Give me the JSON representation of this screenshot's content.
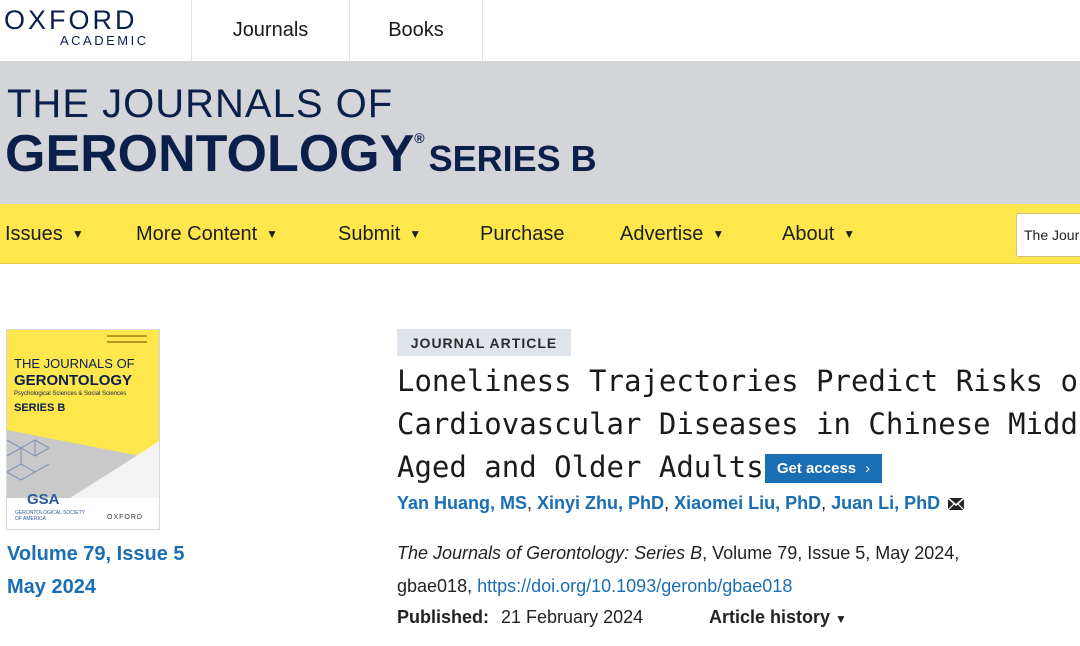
{
  "top": {
    "logo_main": "OXFORD",
    "logo_sub": "ACADEMIC",
    "links": [
      "Journals",
      "Books"
    ]
  },
  "banner": {
    "line1": "THE JOURNALS OF",
    "line2": "GERONTOLOGY",
    "reg": "®",
    "series": "SERIES B"
  },
  "nav": {
    "items": [
      "Issues",
      "More Content",
      "Submit",
      "Purchase",
      "Advertise",
      "About"
    ],
    "caret": "▼",
    "search_value": "The Journ"
  },
  "cover": {
    "line1": "THE JOURNALS OF",
    "line2": "GERONTOLOGY",
    "line3": "Psychological Sciences & Social Sciences",
    "line4": "SERIES B",
    "gsa": "GSA",
    "gsa_sub": "GERONTOLOGICAL SOCIETY OF AMERICA",
    "ou": "OXFORD"
  },
  "issue": {
    "volume": "Volume 79, Issue 5",
    "date": "May 2024"
  },
  "article": {
    "badge": "JOURNAL ARTICLE",
    "title_lines": [
      "Loneliness Trajectories Predict Risks of",
      "Cardiovascular Diseases in Chinese Middle-",
      "Aged and Older Adults"
    ],
    "get_access": "Get access",
    "get_access_chev": "›",
    "authors": [
      "Yan Huang, MS",
      "Xinyi Zhu, PhD",
      "Xiaomei Liu, PhD",
      "Juan Li, PhD"
    ],
    "cite_journal": "The Journals of Gerontology: Series B",
    "cite_rest": ", Volume 79, Issue 5, May 2024,",
    "cite_id": "gbae018, ",
    "doi": "https://doi.org/10.1093/geronb/gbae018",
    "published_label": "Published:",
    "published_date": "21 February 2024",
    "history": "Article history",
    "history_caret": "▼"
  },
  "colors": {
    "nav_yellow": "#fde74c",
    "banner_gray": "#d4d5d8",
    "link_blue": "#1a6eb3",
    "navy": "#0b1f4b"
  }
}
